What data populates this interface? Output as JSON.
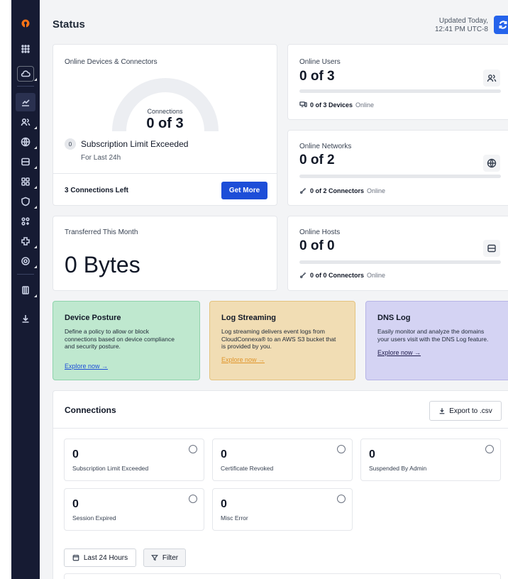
{
  "header": {
    "title": "Status",
    "updated_line1": "Updated Today,",
    "updated_line2": "12:41 PM UTC-8"
  },
  "devices_card": {
    "title": "Online Devices & Connectors",
    "gauge_label": "Connections",
    "gauge_value": "0 of 3",
    "gauge_fraction": 0,
    "badge": "0",
    "limit_text": "Subscription Limit Exceeded",
    "period": "For Last 24h",
    "connections_left": "3 Connections Left",
    "get_more": "Get More"
  },
  "users_card": {
    "title": "Online Users",
    "value": "0 of 3",
    "progress": 0,
    "meta_bold": "0 of 3 Devices",
    "meta_suffix": "Online"
  },
  "networks_card": {
    "title": "Online Networks",
    "value": "0 of 2",
    "progress": 0,
    "meta_bold": "0 of 2 Connectors",
    "meta_suffix": "Online"
  },
  "hosts_card": {
    "title": "Online Hosts",
    "value": "0 of 0",
    "progress": 0,
    "meta_bold": "0 of 0 Connectors",
    "meta_suffix": "Online"
  },
  "transfer_card": {
    "title": "Transferred This Month",
    "value": "0 Bytes"
  },
  "promos": {
    "posture": {
      "title": "Device Posture",
      "desc": [
        "Define a policy to allow or block",
        "connections based on device compliance",
        "and security posture."
      ],
      "link": "Explore now →",
      "bg": "#bfe8cf",
      "border": "#8fd3ab",
      "link_color": "#1d4ed8"
    },
    "logstream": {
      "title": "Log Streaming",
      "desc": [
        "Log streaming delivers event logs from",
        "CloudConnexa® to an AWS S3 bucket that",
        "is provided by you."
      ],
      "link": "Explore now →",
      "bg": "#f1ddb4",
      "border": "#e4c37f",
      "link_color": "#e0952a"
    },
    "dnslog": {
      "title": "DNS Log",
      "desc": [
        "Easily monitor and analyze the domains",
        "your users visit with the DNS Log feature."
      ],
      "link": "Explore now →",
      "bg": "#d4d3f3",
      "border": "#b6b4e6",
      "link_color": "#1e1b4b"
    }
  },
  "connections": {
    "title": "Connections",
    "export": "Export to .csv",
    "stats": [
      {
        "value": "0",
        "label": "Subscription Limit Exceeded"
      },
      {
        "value": "0",
        "label": "Certificate Revoked"
      },
      {
        "value": "0",
        "label": "Suspended By Admin"
      },
      {
        "value": "0",
        "label": "Session Expired"
      },
      {
        "value": "0",
        "label": "Misc Error"
      }
    ],
    "range_button": "Last 24 Hours",
    "filter_button": "Filter"
  },
  "sidebar": {
    "icons": [
      "logo-icon",
      "grid-icon",
      "cloud-icon",
      "chart-icon",
      "users-icon",
      "globe-icon",
      "server-icon",
      "apps-icon",
      "shield-icon",
      "group-icon",
      "puzzle-icon",
      "settings-icon",
      "book-icon",
      "download-icon"
    ]
  },
  "colors": {
    "sidebar": "#161b33",
    "accent": "#2563eb"
  }
}
